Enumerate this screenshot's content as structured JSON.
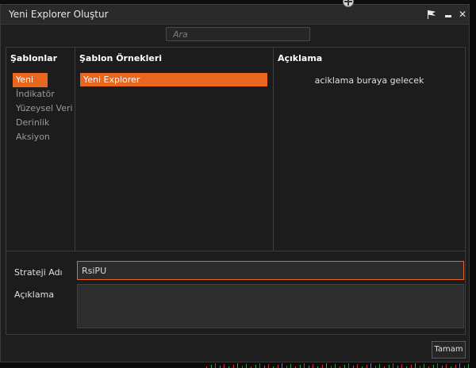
{
  "window": {
    "title": "Yeni Explorer Oluştur",
    "buttons": {
      "pin": "pin-icon",
      "minimize": "minimize-icon",
      "close": "✕"
    }
  },
  "search": {
    "placeholder": "Ara",
    "value": ""
  },
  "templates": {
    "header": "Şablonlar",
    "items": [
      {
        "label": "Yeni",
        "selected": true
      },
      {
        "label": "İndikatör",
        "selected": false
      },
      {
        "label": "Yüzeysel Veri",
        "selected": false
      },
      {
        "label": "Derinlik",
        "selected": false
      },
      {
        "label": "Aksiyon",
        "selected": false
      }
    ]
  },
  "examples": {
    "header": "Şablon Örnekleri",
    "items": [
      {
        "label": "Yeni Explorer",
        "selected": true
      }
    ]
  },
  "description_panel": {
    "header": "Açıklama",
    "text": "aciklama buraya gelecek"
  },
  "form": {
    "strategy_name_label": "Strateji Adı",
    "strategy_name_value": "RsiPU",
    "description_label": "Açıklama",
    "description_value": ""
  },
  "footer": {
    "ok_label": "Tamam"
  },
  "colors": {
    "accent": "#e8661e",
    "background": "#1e1e1e"
  }
}
